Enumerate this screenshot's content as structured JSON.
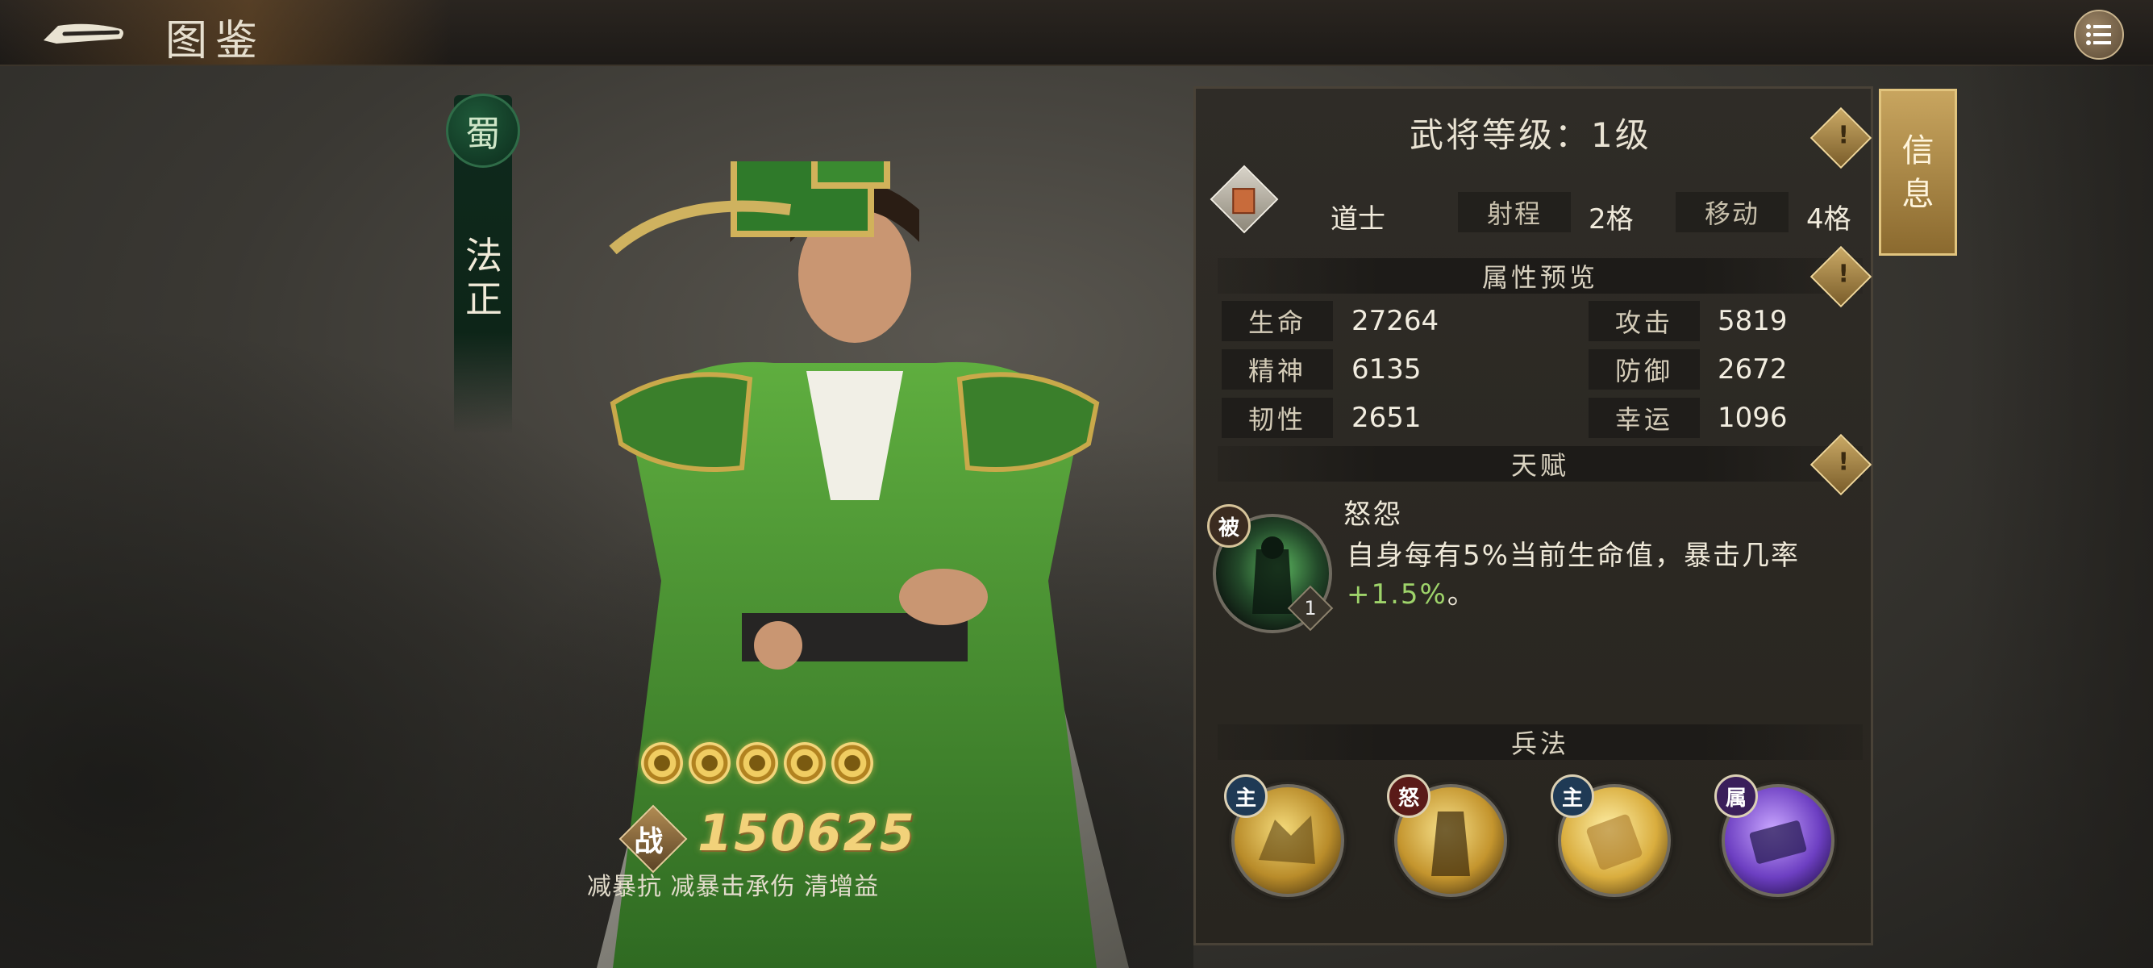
{
  "header": {
    "title": "图鉴"
  },
  "hero": {
    "faction": "蜀",
    "name": "法正",
    "stars": 5,
    "power_icon": "战",
    "power": "150625",
    "tags": "减暴抗 减暴击承伤 清增益"
  },
  "panel": {
    "side_tab": "信息",
    "level_text": "武将等级：1级",
    "class_name": "道士",
    "range_label": "射程",
    "range_value": "2格",
    "move_label": "移动",
    "move_value": "4格",
    "hint_symbol": "!",
    "attributes_title": "属性预览",
    "stats": [
      {
        "label": "生命",
        "value": "27264"
      },
      {
        "label": "攻击",
        "value": "5819"
      },
      {
        "label": "精神",
        "value": "6135"
      },
      {
        "label": "防御",
        "value": "2672"
      },
      {
        "label": "韧性",
        "value": "2651"
      },
      {
        "label": "幸运",
        "value": "1096"
      }
    ],
    "talent_title": "天赋",
    "talent": {
      "tag": "被",
      "level": "1",
      "name": "怒怨",
      "desc_main": "自身每有5%当前生命值，暴击几率",
      "desc_bonus": "+1.5%",
      "desc_end": "。"
    },
    "skills_title": "兵法",
    "skills": [
      {
        "tag": "主",
        "icon": "wolf-skill-icon"
      },
      {
        "tag": "怒",
        "icon": "warrior-skill-icon"
      },
      {
        "tag": "主",
        "icon": "scroll-skill-icon"
      },
      {
        "tag": "属",
        "icon": "book-skill-icon"
      }
    ]
  },
  "colors": {
    "gold": "#f2d27a",
    "talent_bonus": "#9ed36a",
    "shu_green": "#1f5a3a"
  }
}
